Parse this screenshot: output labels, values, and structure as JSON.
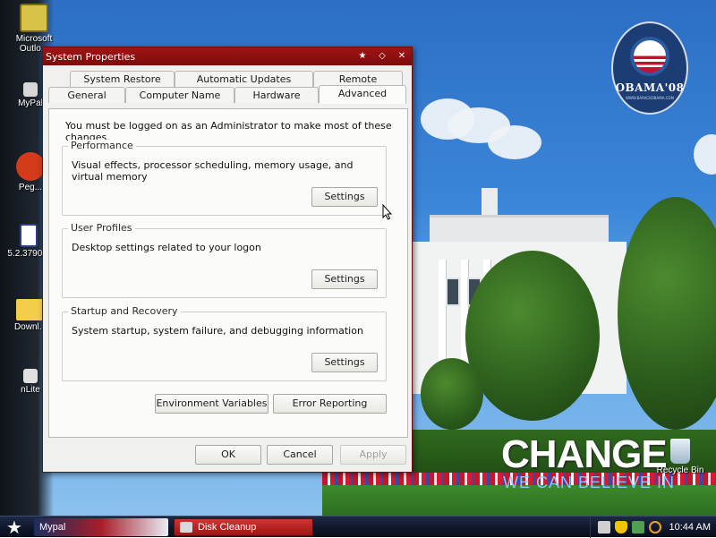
{
  "window": {
    "title": "System Properties",
    "tabs_row1": [
      {
        "label": "System Restore"
      },
      {
        "label": "Automatic Updates"
      },
      {
        "label": "Remote"
      }
    ],
    "tabs_row2": [
      {
        "label": "General"
      },
      {
        "label": "Computer Name"
      },
      {
        "label": "Hardware"
      },
      {
        "label": "Advanced",
        "active": true
      }
    ],
    "intro": "You must be logged on as an Administrator to make most of these changes.",
    "performance": {
      "title": "Performance",
      "description": "Visual effects, processor scheduling, memory usage, and virtual memory",
      "button": "Settings"
    },
    "user_profiles": {
      "title": "User Profiles",
      "description": "Desktop settings related to your logon",
      "button": "Settings"
    },
    "startup_recovery": {
      "title": "Startup and Recovery",
      "description": "System startup, system failure, and debugging information",
      "button": "Settings"
    },
    "env_button": "Environment Variables",
    "error_button": "Error Reporting",
    "ok_button": "OK",
    "cancel_button": "Cancel",
    "apply_button": "Apply"
  },
  "desktop_icons": [
    {
      "label": "Microsoft Outlo...",
      "icon": "outlook-icon"
    },
    {
      "label": "MyPal",
      "icon": "mypal-shortcut-icon"
    },
    {
      "label": "Peg...",
      "icon": "pegasus-icon"
    },
    {
      "label": "5.2.3790...",
      "icon": "document-icon"
    },
    {
      "label": "Downl...",
      "icon": "folder-icon"
    },
    {
      "label": "nLite",
      "icon": "nlite-shortcut-icon"
    }
  ],
  "wallpaper": {
    "logo_text": "OBAMA'08",
    "logo_sub": "WWW.BARACKOBAMA.COM",
    "headline": "CHANGE",
    "tagline": "WE CAN BELIEVE IN"
  },
  "recycle_bin": {
    "label": "Recycle Bin"
  },
  "taskbar": {
    "tasks": [
      {
        "label": "Mypal"
      },
      {
        "label": "Disk Cleanup"
      }
    ],
    "clock": "10:44 AM"
  },
  "colors": {
    "titlebar": "#8e1010",
    "taskbar": "#0f1628",
    "disk_cleanup_task": "#b82424"
  }
}
